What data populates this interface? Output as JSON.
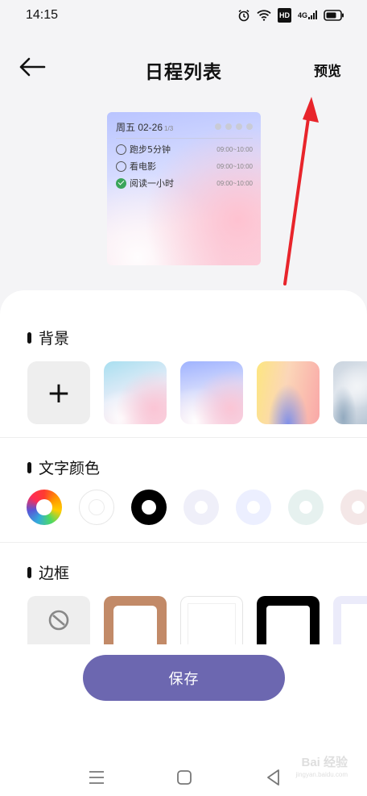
{
  "status": {
    "time": "14:15",
    "hd_badge": "HD",
    "network": "4G"
  },
  "header": {
    "title": "日程列表",
    "preview_label": "预览"
  },
  "widget": {
    "weekday_date": "周五 02-26",
    "page_indicator": "1/3",
    "items": [
      {
        "text": "跑步5分钟",
        "time": "09:00~10:00",
        "done": false
      },
      {
        "text": "看电影",
        "time": "09:00~10:00",
        "done": false
      },
      {
        "text": "阅读一小时",
        "time": "09:00~10:00",
        "done": true
      }
    ]
  },
  "sections": {
    "background": {
      "title": "背景",
      "add_symbol": "+"
    },
    "text_color": {
      "title": "文字颜色",
      "options": [
        "rainbow",
        "#ffffff",
        "#000000",
        "#efeff9",
        "#ecefff",
        "#e6f1ef",
        "#f4e7e7"
      ],
      "selected": "#000000"
    },
    "border": {
      "title": "边框"
    }
  },
  "save_label": "保存",
  "accent_color": "#6c67b0",
  "watermark": {
    "text": "Bai 经验",
    "sub": "jingyan.baidu.com"
  }
}
